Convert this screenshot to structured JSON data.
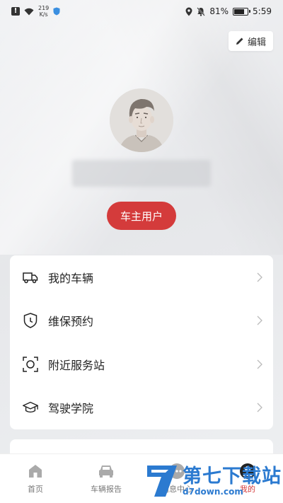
{
  "status_bar": {
    "net_speed": "219",
    "net_unit": "K/s",
    "battery_percent": "81%",
    "battery_level": 0.81,
    "time": "5:59"
  },
  "header": {
    "edit_label": "编辑"
  },
  "profile": {
    "username": "",
    "role_badge": "车主用户"
  },
  "menu": {
    "items": [
      {
        "label": "我的车辆",
        "icon": "truck-icon"
      },
      {
        "label": "维保预约",
        "icon": "shield-clock-icon"
      },
      {
        "label": "附近服务站",
        "icon": "scan-frame-icon"
      },
      {
        "label": "驾驶学院",
        "icon": "graduation-cap-icon"
      }
    ]
  },
  "bottom_nav": {
    "items": [
      {
        "label": "首页",
        "icon": "home-icon"
      },
      {
        "label": "车辆报告",
        "icon": "car-icon"
      },
      {
        "label": "消息中心",
        "icon": "message-icon"
      },
      {
        "label": "我的",
        "icon": "user-icon"
      }
    ]
  },
  "watermark": {
    "main": "第七下载站",
    "sub": "d7down.com"
  },
  "colors": {
    "accent": "#d43b3b",
    "watermark": "#2b7ad0"
  }
}
